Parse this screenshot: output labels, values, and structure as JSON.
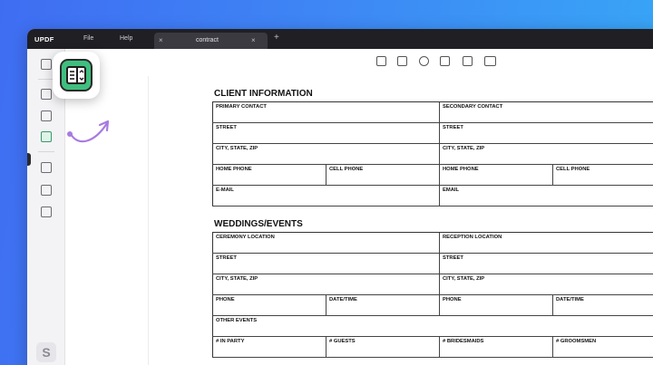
{
  "titlebar": {
    "logo": "UPDF",
    "menu": [
      "File",
      "Help"
    ],
    "tab_name": "contract",
    "tab_close": "×",
    "tab_x_left": "×",
    "new_tab": "+"
  },
  "sidebar": {
    "icons": [
      "page-thumbnail-icon",
      "stamp-icon",
      "edit-icon",
      "form-icon",
      "ocr-icon",
      "organize-icon",
      "compress-icon"
    ],
    "bottom_logo": "S"
  },
  "toolbar": {
    "icons": [
      "text-field-icon",
      "checkbox-icon",
      "radio-button-icon",
      "list-box-icon",
      "dropdown-icon",
      "button-icon"
    ]
  },
  "form": {
    "client": {
      "title": "CLIENT INFORMATION",
      "rows": [
        [
          "PRIMARY CONTACT",
          "SECONDARY CONTACT"
        ],
        [
          "STREET",
          "STREET"
        ],
        [
          "CITY, STATE, ZIP",
          "CITY, STATE, ZIP"
        ],
        [
          "HOME PHONE",
          "CELL PHONE",
          "HOME PHONE",
          "CELL PHONE"
        ],
        [
          "E-MAIL",
          "EMAIL"
        ]
      ]
    },
    "weddings": {
      "title": "WEDDINGS/EVENTS",
      "rows": [
        [
          "CEREMONY LOCATION",
          "RECEPTION LOCATION"
        ],
        [
          "STREET",
          "STREET"
        ],
        [
          "CITY, STATE, ZIP",
          "CITY, STATE, ZIP"
        ],
        [
          "PHONE",
          "DATE/TIME",
          "PHONE",
          "DATE/TIME"
        ],
        [
          "OTHER EVENTS"
        ],
        [
          "# IN PARTY",
          "# GUESTS",
          "# BRIDESMAIDS",
          "# GROOMSMEN"
        ]
      ]
    }
  },
  "colors": {
    "accent_green": "#3fbf7f",
    "arrow_purple": "#a87be0",
    "background_blue": "#3e86f5"
  }
}
